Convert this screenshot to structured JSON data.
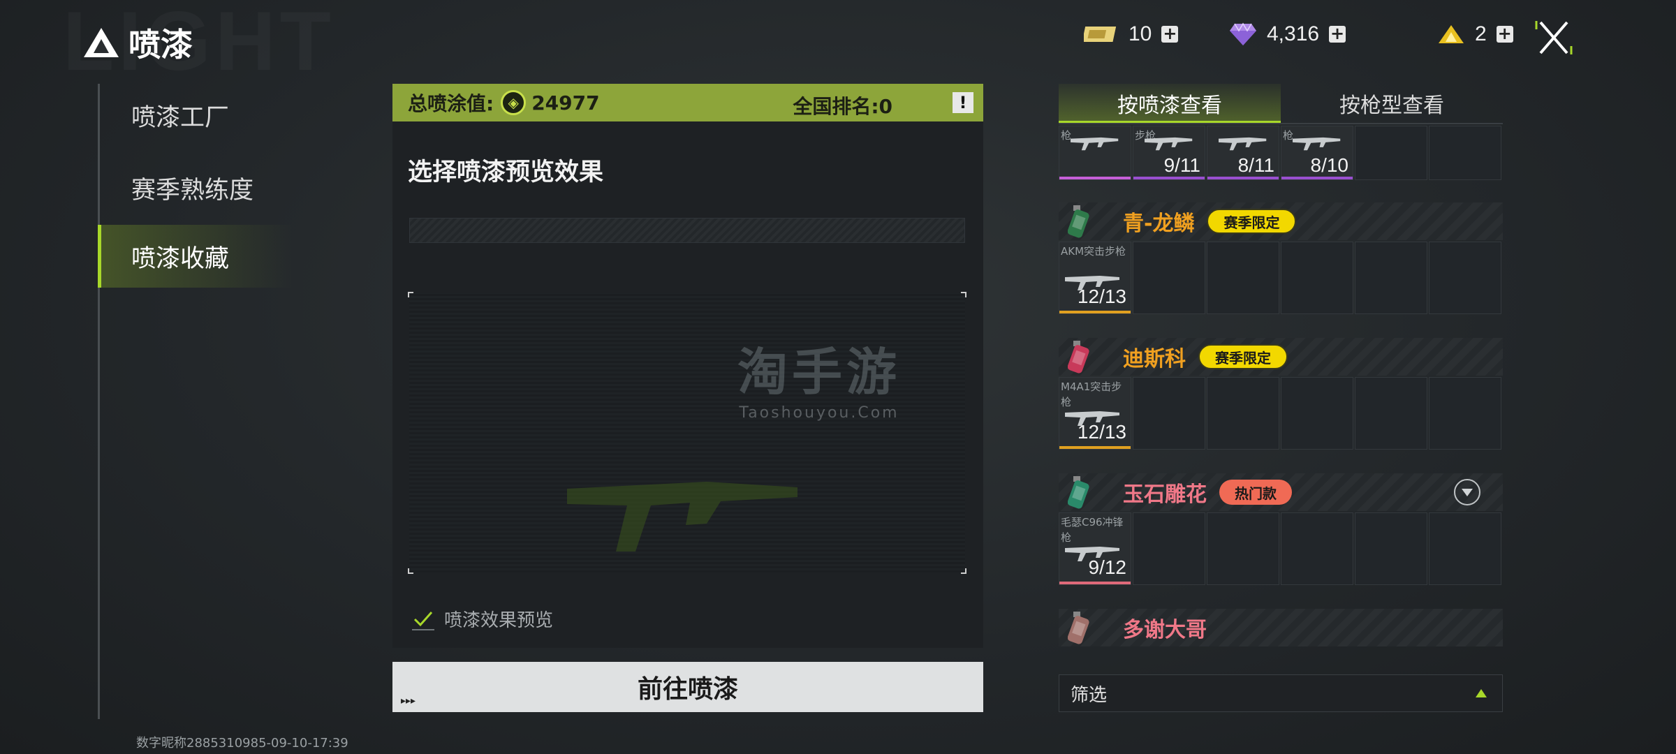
{
  "header": {
    "title": "喷漆",
    "bg_text": "LIGHT",
    "currencies": [
      {
        "icon": "ticket-icon",
        "value": "10"
      },
      {
        "icon": "diamond-icon",
        "value": "4,316"
      },
      {
        "icon": "gold-triangle-icon",
        "value": "2"
      }
    ]
  },
  "nav": {
    "items": [
      {
        "label": "喷漆工厂",
        "active": false
      },
      {
        "label": "赛季熟练度",
        "active": false
      },
      {
        "label": "喷漆收藏",
        "active": true
      }
    ]
  },
  "footer": {
    "id_text": "数字昵称2885310985-09-10-17:39"
  },
  "center": {
    "score_label": "总喷涂值:",
    "score_value": "24977",
    "rank_text": "全国排名:0",
    "info_label": "!",
    "preview_title": "选择喷漆预览效果",
    "watermark_cn": "淘手游",
    "watermark_en": "Taoshouyou.Com",
    "checkbox_label": "喷漆效果预览",
    "checkbox_checked": true,
    "go_button": "前往喷漆",
    "go_arrows": "▸▸▸"
  },
  "right": {
    "tabs": [
      {
        "label": "按喷漆查看",
        "active": true
      },
      {
        "label": "按枪型查看",
        "active": false
      }
    ],
    "top_row": [
      {
        "label": "枪",
        "count": "",
        "color": "#c65fd8"
      },
      {
        "label": "步枪",
        "count": "9/11",
        "color": "#9a4fd0"
      },
      {
        "label": "",
        "count": "8/11",
        "color": "#9a4fd0"
      },
      {
        "label": "枪",
        "count": "8/10",
        "color": "#9a4fd0"
      },
      {
        "label": "",
        "count": "",
        "color": ""
      },
      {
        "label": "",
        "count": "",
        "color": ""
      }
    ],
    "sprays": [
      {
        "name": "青-龙鳞",
        "name_color": "#f0a020",
        "badge": "赛季限定",
        "badge_type": "season",
        "weapon": "AKM突击步枪",
        "count": "12/13",
        "underline": "#e0a020",
        "can_color": "#2e7a4a"
      },
      {
        "name": "迪斯科",
        "name_color": "#f0a020",
        "badge": "赛季限定",
        "badge_type": "season",
        "weapon": "M4A1突击步枪",
        "count": "12/13",
        "underline": "#e0a020",
        "can_color": "#c83a5a"
      },
      {
        "name": "玉石雕花",
        "name_color": "#f07888",
        "badge": "热门款",
        "badge_type": "hot",
        "weapon": "毛瑟C96冲锋枪",
        "count": "9/12",
        "underline": "#e06a7a",
        "can_color": "#2a8a6a"
      },
      {
        "name": "多谢大哥",
        "name_color": "#f07888",
        "badge": "",
        "badge_type": "",
        "weapon": "",
        "count": "",
        "underline": "",
        "can_color": "#a0706a"
      }
    ],
    "filter_label": "筛选"
  }
}
